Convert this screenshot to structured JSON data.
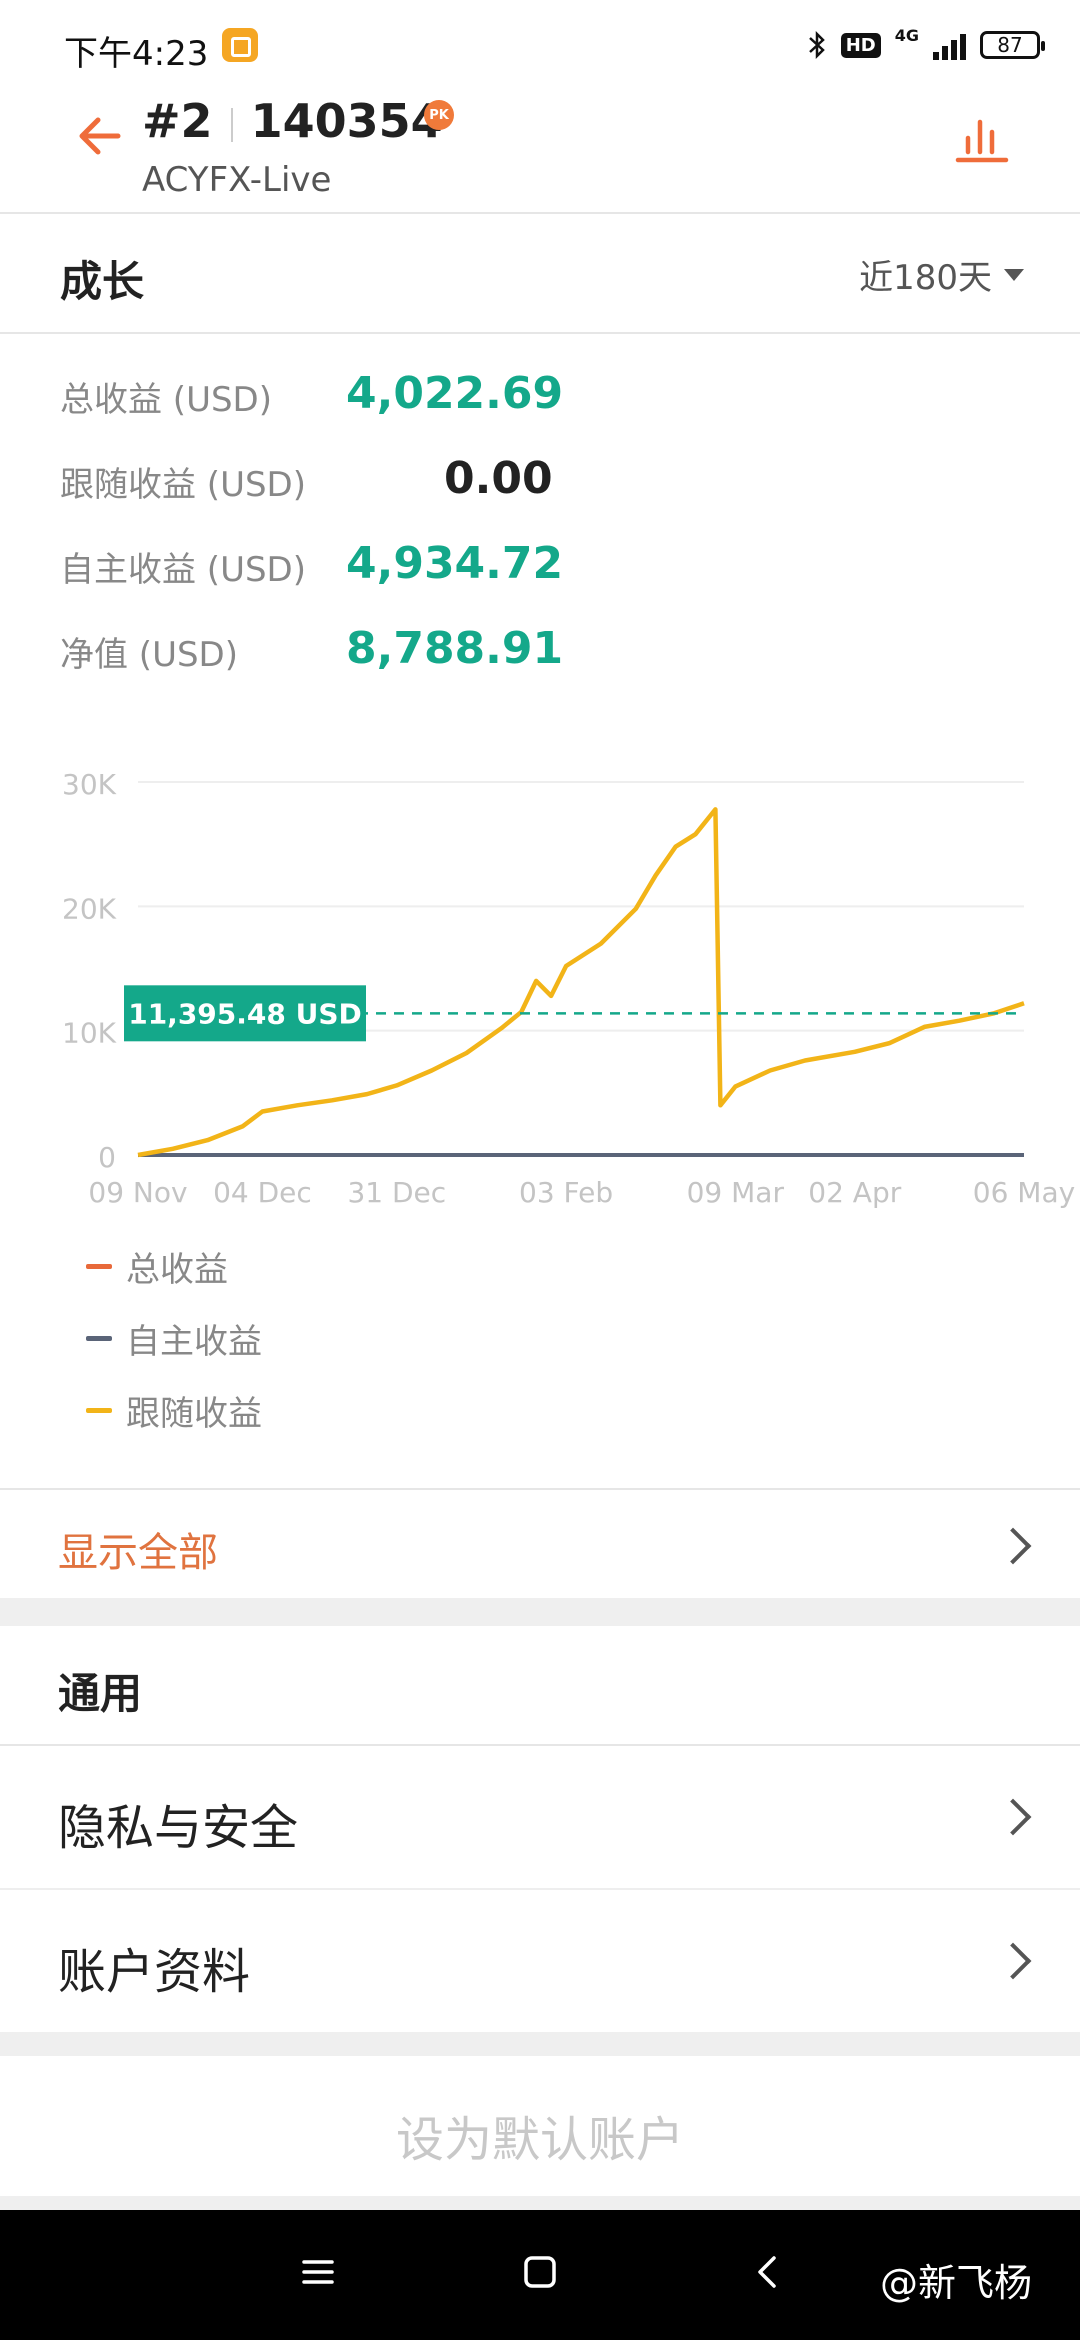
{
  "status_bar": {
    "time": "下午4:23",
    "hd_label": "HD",
    "network_label": "4G",
    "battery": "87"
  },
  "header": {
    "rank": "#2",
    "account_number": "140354",
    "badge": "PK",
    "server": "ACYFX-Live"
  },
  "growth": {
    "title": "成长",
    "range": "近180天"
  },
  "stats": [
    {
      "label": "总收益 (USD)",
      "value": "4,022.69"
    },
    {
      "label": "跟随收益 (USD)",
      "value": "0.00"
    },
    {
      "label": "自主收益 (USD)",
      "value": "4,934.72"
    },
    {
      "label": "净值 (USD)",
      "value": "8,788.91"
    }
  ],
  "chart_data": {
    "type": "line",
    "x_ticks": [
      "09 Nov",
      "04 Dec",
      "31 Dec",
      "03 Feb",
      "09 Mar",
      "02 Apr",
      "06 May"
    ],
    "y_ticks": [
      "0",
      "10K",
      "20K",
      "30K"
    ],
    "ylim": [
      0,
      30000
    ],
    "grid": true,
    "marker_label": "11,395.48 USD",
    "marker_value": 11395.48,
    "legend": [
      "总收益",
      "自主收益",
      "跟随收益"
    ],
    "colors": {
      "总收益": "#e8693a",
      "自主收益": "#5a6478",
      "跟随收益": "#f2b418",
      "marker": "#14a88a"
    },
    "series": [
      {
        "name": "跟随收益",
        "points": [
          [
            "09 Nov",
            0
          ],
          [
            "16 Nov",
            500
          ],
          [
            "23 Nov",
            1200
          ],
          [
            "30 Nov",
            2300
          ],
          [
            "04 Dec",
            3500
          ],
          [
            "11 Dec",
            4000
          ],
          [
            "18 Dec",
            4400
          ],
          [
            "25 Dec",
            4900
          ],
          [
            "31 Dec",
            5600
          ],
          [
            "07 Jan",
            6800
          ],
          [
            "14 Jan",
            8200
          ],
          [
            "21 Jan",
            10200
          ],
          [
            "25 Jan",
            11500
          ],
          [
            "28 Jan",
            14000
          ],
          [
            "31 Jan",
            12800
          ],
          [
            "03 Feb",
            15200
          ],
          [
            "10 Feb",
            17000
          ],
          [
            "17 Feb",
            19800
          ],
          [
            "21 Feb",
            22500
          ],
          [
            "25 Feb",
            24800
          ],
          [
            "01 Mar",
            25800
          ],
          [
            "05 Mar",
            27800
          ],
          [
            "06 Mar",
            4000
          ],
          [
            "09 Mar",
            5500
          ],
          [
            "16 Mar",
            6800
          ],
          [
            "23 Mar",
            7600
          ],
          [
            "02 Apr",
            8300
          ],
          [
            "09 Apr",
            9000
          ],
          [
            "16 Apr",
            10300
          ],
          [
            "23 Apr",
            10800
          ],
          [
            "30 Apr",
            11400
          ],
          [
            "06 May",
            12200
          ]
        ]
      },
      {
        "name": "自主收益",
        "points": [
          [
            "09 Nov",
            0
          ],
          [
            "06 May",
            0
          ]
        ]
      }
    ]
  },
  "actions": {
    "show_all": "显示全部"
  },
  "general": {
    "title": "通用",
    "items": [
      {
        "label": "隐私与安全"
      },
      {
        "label": "账户资料"
      }
    ]
  },
  "set_default": "设为默认账户",
  "watermark": "@新飞杨"
}
